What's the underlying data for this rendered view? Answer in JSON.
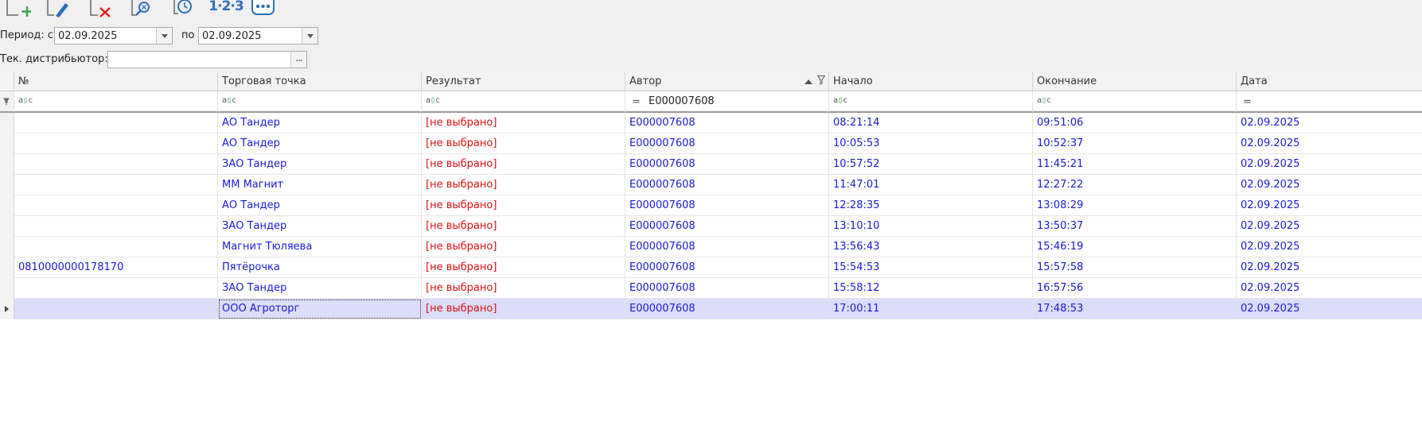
{
  "toolbar": {
    "buttons": [
      {
        "name": "add-button",
        "icon": "add-document-icon"
      },
      {
        "name": "edit-button",
        "icon": "pencil-icon"
      },
      {
        "name": "delete-button",
        "icon": "delete-document-icon"
      },
      {
        "name": "search-button",
        "icon": "magnifier-icon"
      },
      {
        "name": "history-button",
        "icon": "clock-icon"
      },
      {
        "name": "numbering-button",
        "icon": "number-icon",
        "text": "1·2·3"
      },
      {
        "name": "more-button",
        "icon": "ellipsis-icon"
      }
    ]
  },
  "filters": {
    "period_label": "Период: с",
    "date_from": "02.09.2025",
    "to_label": "по",
    "date_to": "02.09.2025",
    "distributor_label": "Тек. дистрибьютор:",
    "distributor_value": ""
  },
  "grid": {
    "columns": [
      "№",
      "Торговая точка",
      "Результат",
      "Автор",
      "Начало",
      "Окончание",
      "Дата"
    ],
    "filter_row": {
      "author_operator": "=",
      "author_value": "E000007608",
      "date_operator": "="
    },
    "rows": [
      [
        "",
        "АО Тандер",
        "[не выбрано]",
        "E000007608",
        "08:21:14",
        "09:51:06",
        "02.09.2025"
      ],
      [
        "",
        "АО Тандер",
        "[не выбрано]",
        "E000007608",
        "10:05:53",
        "10:52:37",
        "02.09.2025"
      ],
      [
        "",
        "ЗАО Тандер",
        "[не выбрано]",
        "E000007608",
        "10:57:52",
        "11:45:21",
        "02.09.2025"
      ],
      [
        "",
        "ММ Магнит",
        "[не выбрано]",
        "E000007608",
        "11:47:01",
        "12:27:22",
        "02.09.2025"
      ],
      [
        "",
        "АО Тандер",
        "[не выбрано]",
        "E000007608",
        "12:28:35",
        "13:08:29",
        "02.09.2025"
      ],
      [
        "",
        "ЗАО Тандер",
        "[не выбрано]",
        "E000007608",
        "13:10:10",
        "13:50:37",
        "02.09.2025"
      ],
      [
        "",
        "Магнит Тюляева",
        "[не выбрано]",
        "E000007608",
        "13:56:43",
        "15:46:19",
        "02.09.2025"
      ],
      [
        "0810000000178170",
        "Пятёрочка",
        "[не выбрано]",
        "E000007608",
        "15:54:53",
        "15:57:58",
        "02.09.2025"
      ],
      [
        "",
        "ЗАО Тандер",
        "[не выбрано]",
        "E000007608",
        "15:58:12",
        "16:57:56",
        "02.09.2025"
      ],
      [
        "",
        "ООО Агроторг",
        "[не выбрано]",
        "E000007608",
        "17:00:11",
        "17:48:53",
        "02.09.2025"
      ]
    ],
    "selected_row": 9,
    "sorted_column": "Автор",
    "colors": {
      "link": "#1a1ad2",
      "result": "#e01010",
      "selection": "#dcdcfb"
    }
  }
}
